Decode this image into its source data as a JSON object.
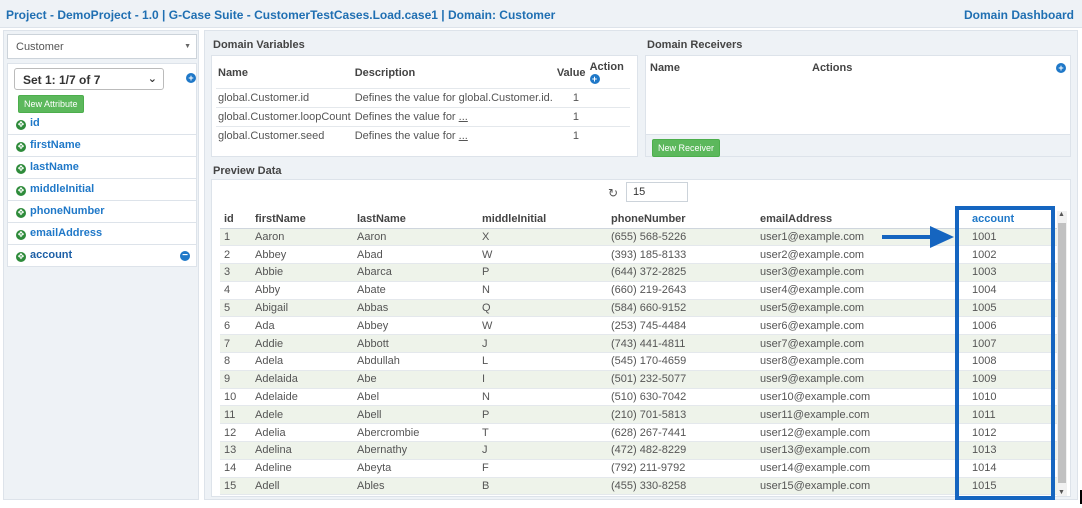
{
  "header": {
    "title": "Project - DemoProject - 1.0 | G-Case Suite - CustomerTestCases.Load.case1 | Domain: Customer",
    "dashboard_link": "Domain Dashboard"
  },
  "left": {
    "domain_select": "Customer",
    "set_select": "Set 1: 1/7 of 7",
    "new_attribute": "New Attribute",
    "attributes": [
      {
        "label": "id"
      },
      {
        "label": "firstName"
      },
      {
        "label": "lastName"
      },
      {
        "label": "middleInitial"
      },
      {
        "label": "phoneNumber"
      },
      {
        "label": "emailAddress"
      },
      {
        "label": "account",
        "selected": true
      }
    ]
  },
  "domain_variables": {
    "title": "Domain Variables",
    "columns": [
      "Name",
      "Description",
      "Value",
      "Action"
    ],
    "rows": [
      {
        "name": "global.Customer.id",
        "description": "Defines the value for global.Customer.id.",
        "value": "1"
      },
      {
        "name": "global.Customer.loopCount",
        "description": "Defines the value for ",
        "more": "...",
        "value": "1"
      },
      {
        "name": "global.Customer.seed",
        "description": "Defines the value for ",
        "more": "...",
        "value": "1"
      }
    ]
  },
  "domain_receivers": {
    "title": "Domain Receivers",
    "columns": [
      "Name",
      "Actions"
    ],
    "new_receiver": "New Receiver"
  },
  "preview": {
    "title": "Preview Data",
    "row_count": "15",
    "columns": [
      "id",
      "firstName",
      "lastName",
      "middleInitial",
      "phoneNumber",
      "emailAddress",
      "account"
    ],
    "rows": [
      [
        "1",
        "Aaron",
        "Aaron",
        "X",
        "(655) 568-5226",
        "user1@example.com",
        "1001"
      ],
      [
        "2",
        "Abbey",
        "Abad",
        "W",
        "(393) 185-8133",
        "user2@example.com",
        "1002"
      ],
      [
        "3",
        "Abbie",
        "Abarca",
        "P",
        "(644) 372-2825",
        "user3@example.com",
        "1003"
      ],
      [
        "4",
        "Abby",
        "Abate",
        "N",
        "(660) 219-2643",
        "user4@example.com",
        "1004"
      ],
      [
        "5",
        "Abigail",
        "Abbas",
        "Q",
        "(584) 660-9152",
        "user5@example.com",
        "1005"
      ],
      [
        "6",
        "Ada",
        "Abbey",
        "W",
        "(253) 745-4484",
        "user6@example.com",
        "1006"
      ],
      [
        "7",
        "Addie",
        "Abbott",
        "J",
        "(743) 441-4811",
        "user7@example.com",
        "1007"
      ],
      [
        "8",
        "Adela",
        "Abdullah",
        "L",
        "(545) 170-4659",
        "user8@example.com",
        "1008"
      ],
      [
        "9",
        "Adelaida",
        "Abe",
        "I",
        "(501) 232-5077",
        "user9@example.com",
        "1009"
      ],
      [
        "10",
        "Adelaide",
        "Abel",
        "N",
        "(510) 630-7042",
        "user10@example.com",
        "1010"
      ],
      [
        "11",
        "Adele",
        "Abell",
        "P",
        "(210) 701-5813",
        "user11@example.com",
        "1011"
      ],
      [
        "12",
        "Adelia",
        "Abercrombie",
        "T",
        "(628) 267-7441",
        "user12@example.com",
        "1012"
      ],
      [
        "13",
        "Adelina",
        "Abernathy",
        "J",
        "(472) 482-8229",
        "user13@example.com",
        "1013"
      ],
      [
        "14",
        "Adeline",
        "Abeyta",
        "F",
        "(792) 211-9792",
        "user14@example.com",
        "1014"
      ],
      [
        "15",
        "Adell",
        "Ables",
        "B",
        "(455) 330-8258",
        "user15@example.com",
        "1015"
      ]
    ]
  },
  "colors": {
    "accent": "#1f78c8",
    "highlight_frame": "#1565c0",
    "green_button": "#5cb85c"
  }
}
